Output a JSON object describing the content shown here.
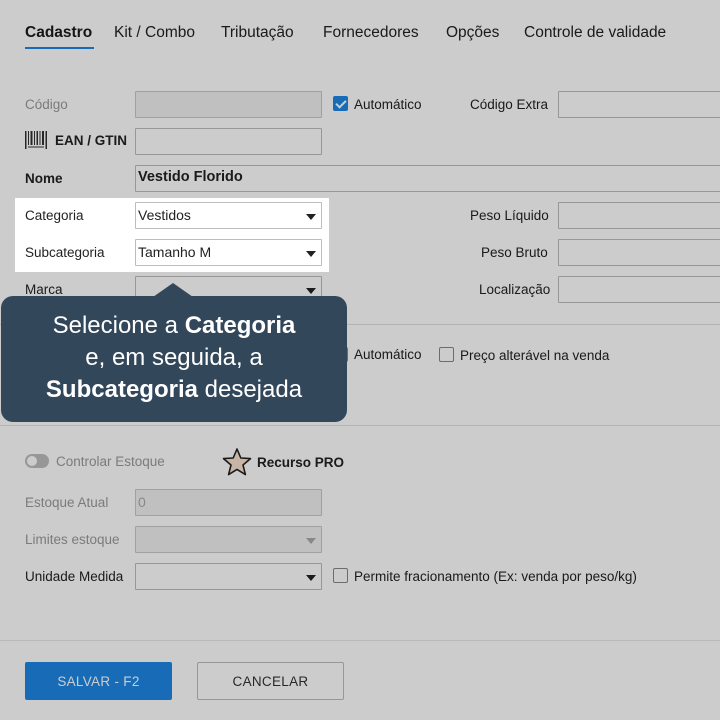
{
  "tabs": [
    {
      "label": "Cadastro",
      "active": true
    },
    {
      "label": "Kit / Combo"
    },
    {
      "label": "Tributação"
    },
    {
      "label": "Fornecedores"
    },
    {
      "label": "Opções"
    },
    {
      "label": "Controle de validade"
    }
  ],
  "form": {
    "codigo_label": "Código",
    "automatico_label": "Automático",
    "codigo_extra_label": "Código Extra",
    "ean_label": "EAN / GTIN",
    "nome_label": "Nome",
    "nome_value": "Vestido Florido",
    "categoria_label": "Categoria",
    "categoria_value": "Vestidos",
    "subcategoria_label": "Subcategoria",
    "subcategoria_value": "Tamanho M",
    "marca_label": "Marca",
    "peso_liquido_label": "Peso Líquido",
    "peso_bruto_label": "Peso Bruto",
    "localizacao_label": "Localização",
    "automatico2_label": "Automático",
    "preco_alteravel_label": "Preço alterável na venda",
    "controlar_estoque_label": "Controlar Estoque",
    "recurso_pro_label": "Recurso PRO",
    "estoque_atual_label": "Estoque Atual",
    "estoque_atual_value": "0",
    "limites_estoque_label": "Limites estoque",
    "unidade_medida_label": "Unidade Medida",
    "permite_fracionamento_label": "Permite fracionamento (Ex: venda por peso/kg)"
  },
  "buttons": {
    "save": "SALVAR - F2",
    "cancel": "CANCELAR"
  },
  "tooltip": {
    "line1_pre": "Selecione a ",
    "line1_bold": "Categoria",
    "line2": "e, em seguida, a",
    "line3_bold": "Subcategoria",
    "line3_post": " desejada"
  },
  "colors": {
    "accent": "#1e88e5",
    "tooltip_bg": "#33475b"
  }
}
